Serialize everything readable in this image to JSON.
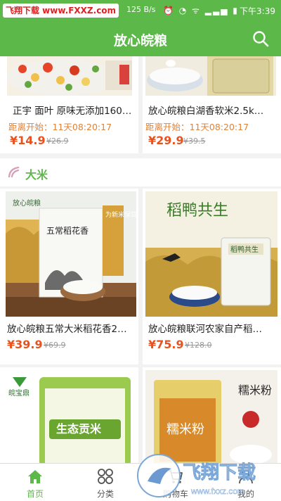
{
  "status_bar": {
    "watermark": "飞翔下载 www.FXXZ.com",
    "speed": "125 B/s",
    "icons": "⏰ ◔ ᯤ ▂▃▅ ▮",
    "time": "下午3:39"
  },
  "app_bar": {
    "title": "放心皖粮",
    "search_icon": "search-icon"
  },
  "flash_sale": {
    "items": [
      {
        "name": "正宇 面叶 原味无添加160…",
        "countdown": "距离开始：11天08:20:17",
        "price": "¥14.9",
        "old_price": "¥26.9"
      },
      {
        "name": "放心皖粮白湖香软米2.5k…",
        "countdown": "距离开始：11天08:20:17",
        "price": "¥29.9",
        "old_price": "¥39.5"
      }
    ]
  },
  "section": {
    "title": "大米"
  },
  "rice_products": [
    {
      "name": "放心皖粮五常大米稻花香2…",
      "price": "¥39.9",
      "old_price": "¥69.9",
      "image_brand": "放心皖粮",
      "image_title": "五常稻花香",
      "image_slogan": "为新米保驾护航 自直产地"
    },
    {
      "name": "放心皖粮联河农家自产稻…",
      "price": "¥75.9",
      "old_price": "¥128.0",
      "image_title": "稻鸭共生",
      "image_bag_label": "稻鸭共生"
    }
  ],
  "more_products": [
    {
      "image_brand": "皖宝鼎",
      "image_bag_label": "生态贡米"
    },
    {
      "image_title": "糯米粉",
      "image_bag_label": "糯米粉"
    }
  ],
  "tab_bar": {
    "tabs": [
      {
        "label": "首页",
        "icon": "home-icon",
        "active": true
      },
      {
        "label": "分类",
        "icon": "category-icon",
        "active": false
      },
      {
        "label": "购物车",
        "icon": "cart-icon",
        "active": false
      },
      {
        "label": "我的",
        "icon": "user-icon",
        "active": false
      }
    ]
  },
  "watermark_badge": {
    "text": "飞翔下载",
    "url": "www.fxxz.com"
  },
  "colors": {
    "brand_green": "#5db84a",
    "price_red": "#e8521f",
    "countdown_orange": "#e0833a"
  }
}
